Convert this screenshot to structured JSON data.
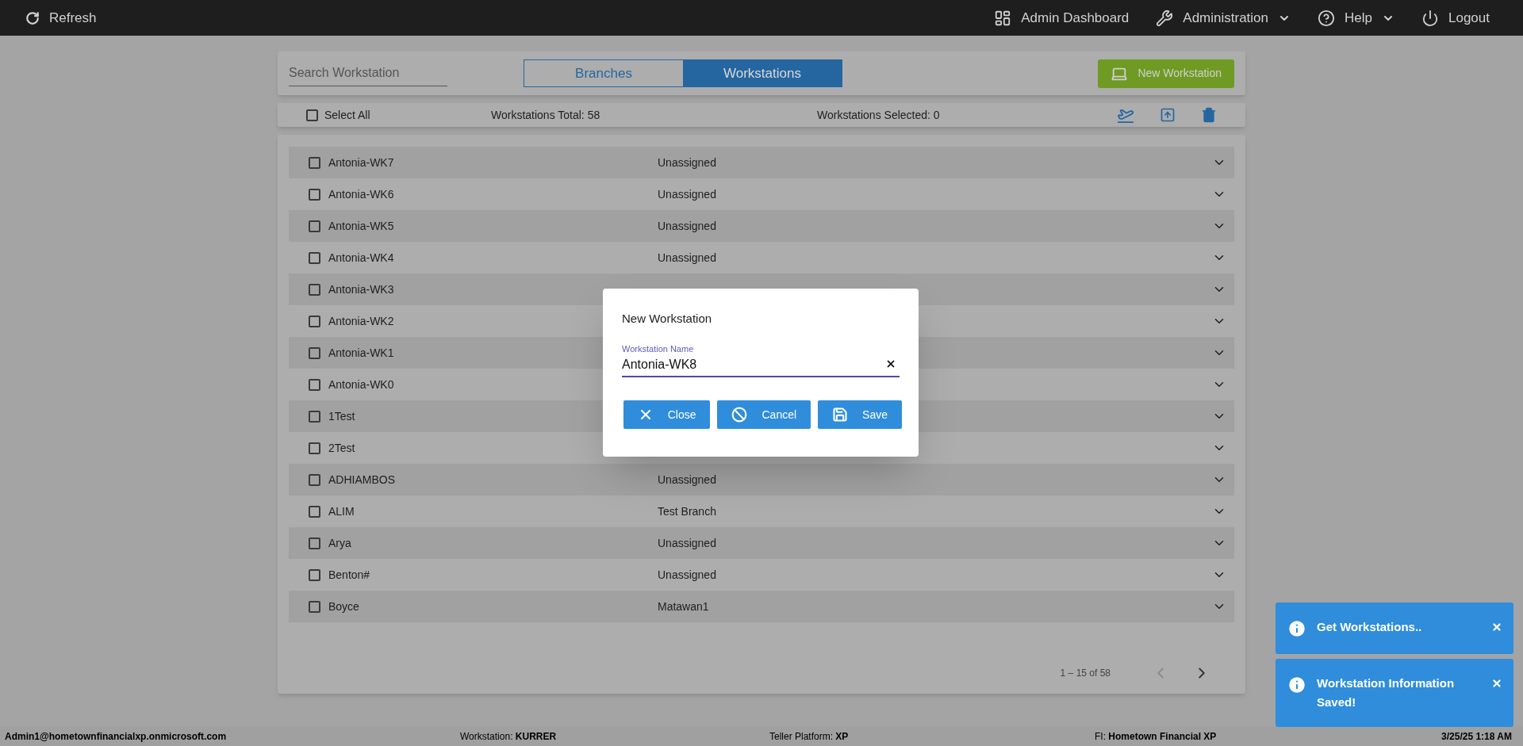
{
  "top_bar": {
    "refresh": "Refresh",
    "menu": [
      {
        "kind": "dashboard",
        "label": "Admin Dashboard",
        "dropdown": false
      },
      {
        "kind": "wrench",
        "label": "Administration",
        "dropdown": true
      },
      {
        "kind": "help",
        "label": "Help",
        "dropdown": true
      },
      {
        "kind": "power",
        "label": "Logout",
        "dropdown": false
      }
    ]
  },
  "search": {
    "placeholder": "Search Workstation"
  },
  "tabs": [
    {
      "label": "Branches",
      "selected": false
    },
    {
      "label": "Workstations",
      "selected": true
    }
  ],
  "new_button": "New Workstation",
  "summary": {
    "select_all": {
      "label": "Select All",
      "checked": false
    },
    "total": "Workstations Total: 58",
    "selected_count": "Workstations Selected: 0"
  },
  "rows": [
    {
      "name": "Antonia-WK7",
      "branch": "Unassigned",
      "checked": false,
      "expanded": false
    },
    {
      "name": "Antonia-WK6",
      "branch": "Unassigned",
      "checked": false,
      "expanded": false
    },
    {
      "name": "Antonia-WK5",
      "branch": "Unassigned",
      "checked": false,
      "expanded": false
    },
    {
      "name": "Antonia-WK4",
      "branch": "Unassigned",
      "checked": false,
      "expanded": false
    },
    {
      "name": "Antonia-WK3",
      "checked": false,
      "expanded": false
    },
    {
      "name": "Antonia-WK2",
      "checked": false,
      "expanded": false
    },
    {
      "name": "Antonia-WK1",
      "checked": false,
      "expanded": false
    },
    {
      "name": "Antonia-WK0",
      "checked": false,
      "expanded": false
    },
    {
      "name": "1Test",
      "checked": false,
      "expanded": false
    },
    {
      "name": "2Test",
      "checked": false,
      "expanded": false
    },
    {
      "name": "ADHIAMBOS",
      "branch": "Unassigned",
      "checked": false,
      "expanded": false
    },
    {
      "name": "ALIM",
      "branch": "Test Branch",
      "checked": false,
      "expanded": false
    },
    {
      "name": "Arya",
      "branch": "Unassigned",
      "checked": false,
      "expanded": false
    },
    {
      "name": "Benton#",
      "branch": "Unassigned",
      "checked": false,
      "expanded": false
    },
    {
      "name": "Boyce",
      "branch": "Matawan1",
      "checked": false,
      "expanded": false
    }
  ],
  "pagination": {
    "range": "1 – 15 of 58",
    "prev_disabled": true,
    "next_disabled": false
  },
  "dialog": {
    "title": "New Workstation",
    "field": {
      "label": "Workstation Name",
      "value": "Antonia-WK8"
    },
    "buttons": [
      {
        "kind": "close",
        "label": "Close"
      },
      {
        "kind": "cancel",
        "label": "Cancel"
      },
      {
        "kind": "save",
        "label": "Save"
      }
    ]
  },
  "toasts": [
    {
      "message": "Get Workstations.."
    },
    {
      "message": "Workstation Information Saved!"
    }
  ],
  "footer": {
    "user": "Admin1@hometownfinancialxp.onmicrosoft.com",
    "items": [
      {
        "label": "Workstation: ",
        "value": "KURRER"
      },
      {
        "label": "Teller Platform: ",
        "value": "XP"
      },
      {
        "label": "FI: ",
        "value": "Hometown Financial XP"
      }
    ],
    "datetime": "3/25/25 1:18 AM"
  }
}
